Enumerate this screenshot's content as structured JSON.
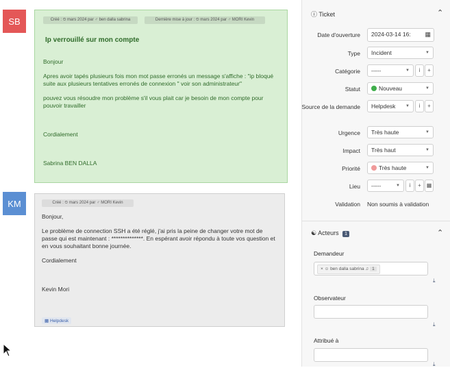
{
  "timeline": {
    "first": {
      "avatar": "SB",
      "avatar_color": "#e45757",
      "created_tag": "Créé : ⏲ mars 2024 par ♂ ben dalla sabrina",
      "updated_tag": "Dernière mise à jour : ⏲ mars 2024 par ♂ MORI Kevin",
      "title": "Ip verrouillé sur mon compte",
      "lines": [
        "Bonjour",
        "Apres avoir tapés plusieurs fois mon mot passe erronés un message s'affiche : \"ip bloqué suite aux plusieurs tentatives erronés de connexion \" voir son administrateur\"",
        "pouvez vous résoudre mon problème s'il vous plait car je besoin de mon compte pour pouvoir travailler",
        "Cordialement",
        "Sabrina BEN DALLA"
      ]
    },
    "second": {
      "avatar": "KM",
      "avatar_color": "#5b8fd3",
      "created_tag": "Créé : ⏲ mars 2024 par ♂ MORI Kevin",
      "lines": [
        "Bonjour,",
        "Le problème de connection SSH a été réglé, j'ai pris la peine de changer votre mot de passe qui est maintenant : **************. En espérant avoir répondu à toute vos question et en vous souhaitant bonne journée.",
        "Cordialement",
        "Kevin Mori"
      ],
      "source_badge": "Helpdesk"
    }
  },
  "ticket": {
    "section_title": "Ticket",
    "opening_date_label": "Date d'ouverture",
    "opening_date_value": "2024-03-14 16:",
    "type_label": "Type",
    "type_value": "Incident",
    "category_label": "Catégorie",
    "category_value": "-----",
    "status_label": "Statut",
    "status_value": "Nouveau",
    "status_color": "#3fae4b",
    "source_label": "Source de la demande",
    "source_value": "Helpdesk",
    "urgency_label": "Urgence",
    "urgency_value": "Très haute",
    "impact_label": "Impact",
    "impact_value": "Très haut",
    "priority_label": "Priorité",
    "priority_value": "Très haute",
    "priority_color": "#f09a9a",
    "location_label": "Lieu",
    "location_value": "-----",
    "validation_label": "Validation",
    "validation_value": "Non soumis à validation"
  },
  "actors": {
    "section_title": "Acteurs",
    "count": "1",
    "requester_label": "Demandeur",
    "requester_value": "ben dalla sabrina",
    "requester_count": "1",
    "observer_label": "Observateur",
    "assigned_label": "Attribué à"
  }
}
